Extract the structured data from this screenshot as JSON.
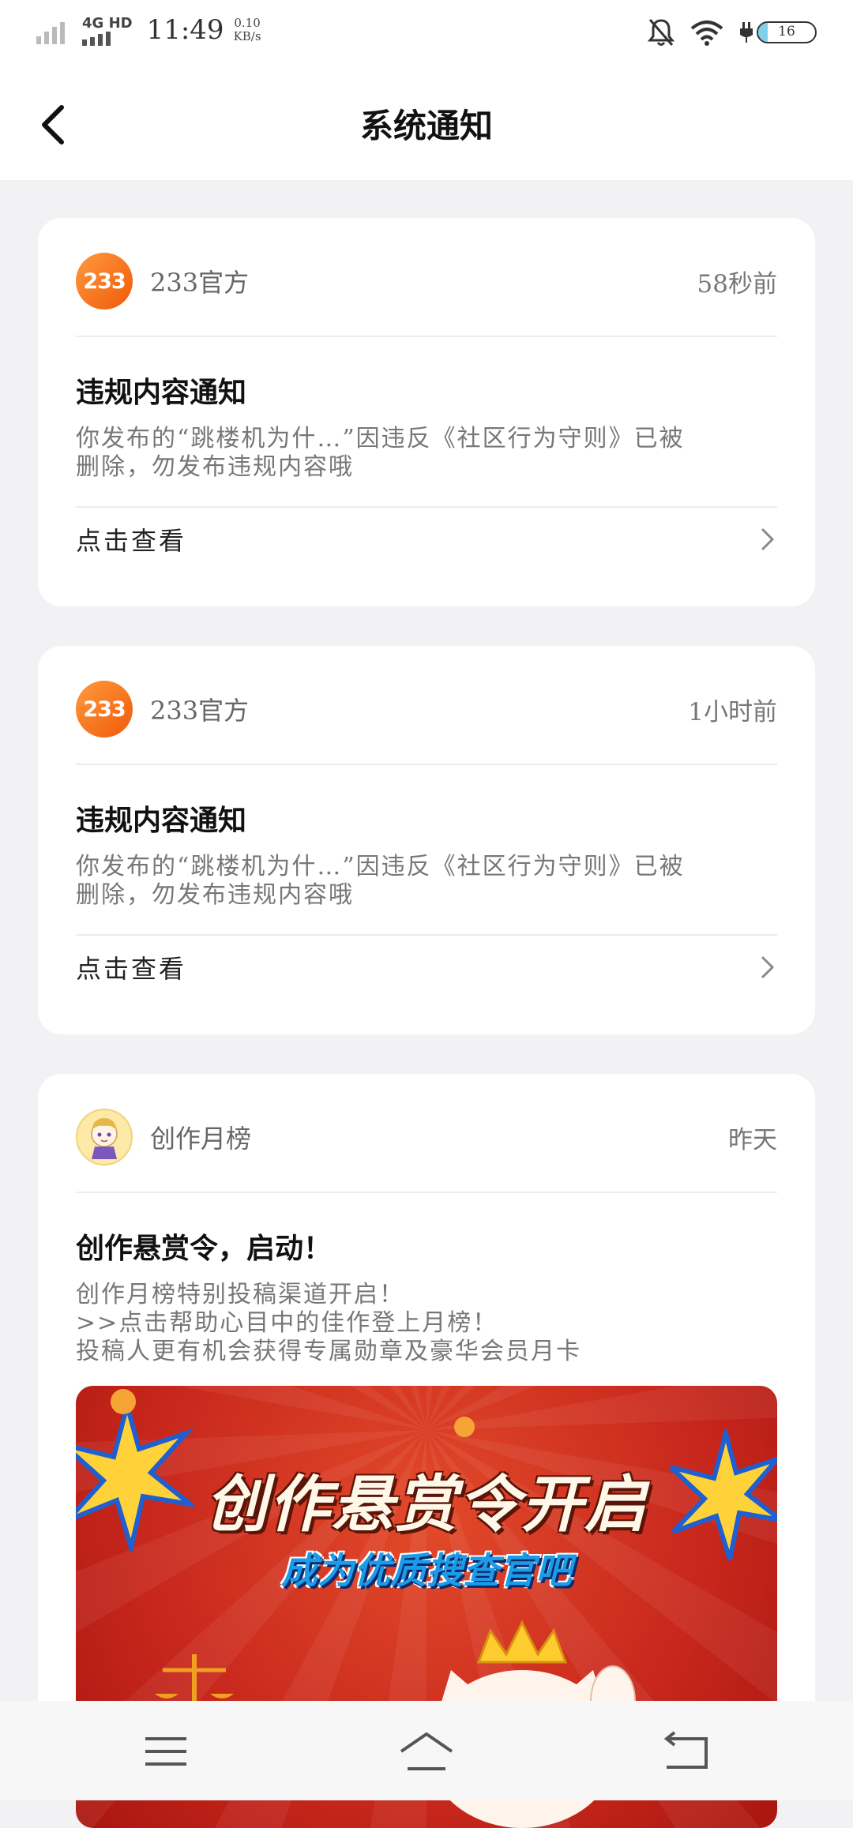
{
  "status_bar": {
    "network": "4G HD",
    "time": "11:49",
    "rate_value": "0.10",
    "rate_unit": "KB/s",
    "battery": "16",
    "battery_level": 0.16,
    "icons": [
      "signal-icon",
      "mute-bell-icon",
      "wifi-icon",
      "charging-icon",
      "battery-icon"
    ]
  },
  "header": {
    "title": "系统通知",
    "back_icon": "chevron-left-icon"
  },
  "notifications": [
    {
      "avatar_text": "233",
      "sender": "233官方",
      "time": "58秒前",
      "title": "违规内容通知",
      "body_lines": [
        "你发布的“跳楼机为什…”因违反《社区行为守则》已被",
        "删除，勿发布违规内容哦"
      ],
      "action": "点击查看"
    },
    {
      "avatar_text": "233",
      "sender": "233官方",
      "time": "1小时前",
      "title": "违规内容通知",
      "body_lines": [
        "你发布的“跳楼机为什…”因违反《社区行为守则》已被",
        "删除，勿发布违规内容哦"
      ],
      "action": "点击查看"
    },
    {
      "sender": "创作月榜",
      "time": "昨天",
      "title": "创作悬赏令，启动！",
      "body_lines": [
        "创作月榜特别投稿渠道开启！",
        ">>点击帮助心目中的佳作登上月榜！",
        "投稿人更有机会获得专属勋章及豪华会员月卡"
      ],
      "banner": {
        "title": "创作悬赏令开启",
        "subtitle": "成为优质搜查官吧"
      }
    }
  ],
  "bottom_nav": {
    "icons": [
      "menu-icon",
      "home-icon",
      "back-icon"
    ]
  }
}
